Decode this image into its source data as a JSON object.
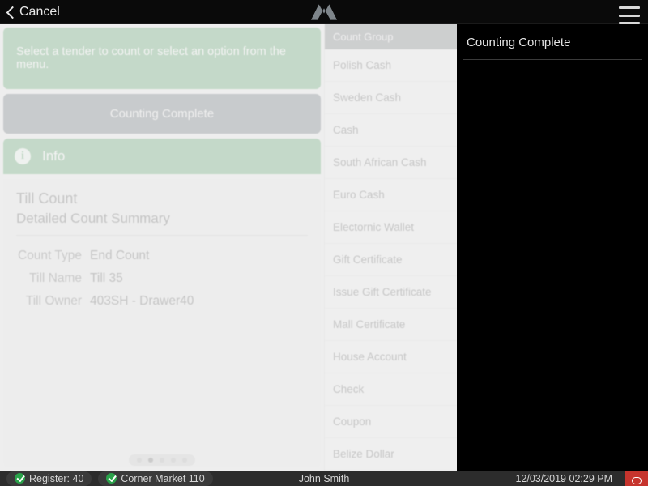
{
  "topbar": {
    "cancel_label": "Cancel"
  },
  "banner": {
    "message": "Select a tender to count or select an option from the menu."
  },
  "primary_button": {
    "label": "Counting Complete"
  },
  "info": {
    "heading": "Info",
    "title": "Till Count",
    "subtitle": "Detailed Count Summary",
    "rows": {
      "count_type_label": "Count Type",
      "count_type_value": "End Count",
      "till_name_label": "Till Name",
      "till_name_value": "Till 35",
      "till_owner_label": "Till Owner",
      "till_owner_value": "403SH - Drawer40"
    }
  },
  "count_group": {
    "header": "Count Group",
    "items": [
      "Polish Cash",
      "Sweden Cash",
      "Cash",
      "South African Cash",
      "Euro Cash",
      "Electornic Wallet",
      "Gift Certificate",
      "Issue Gift Certificate",
      "Mall Certificate",
      "House Account",
      "Check",
      "Coupon",
      "Belize Dollar"
    ]
  },
  "right_panel": {
    "title": "Counting Complete"
  },
  "status": {
    "register": "Register: 40",
    "store": "Corner Market 110",
    "user": "John Smith",
    "datetime": "12/03/2019 02:29 PM"
  }
}
